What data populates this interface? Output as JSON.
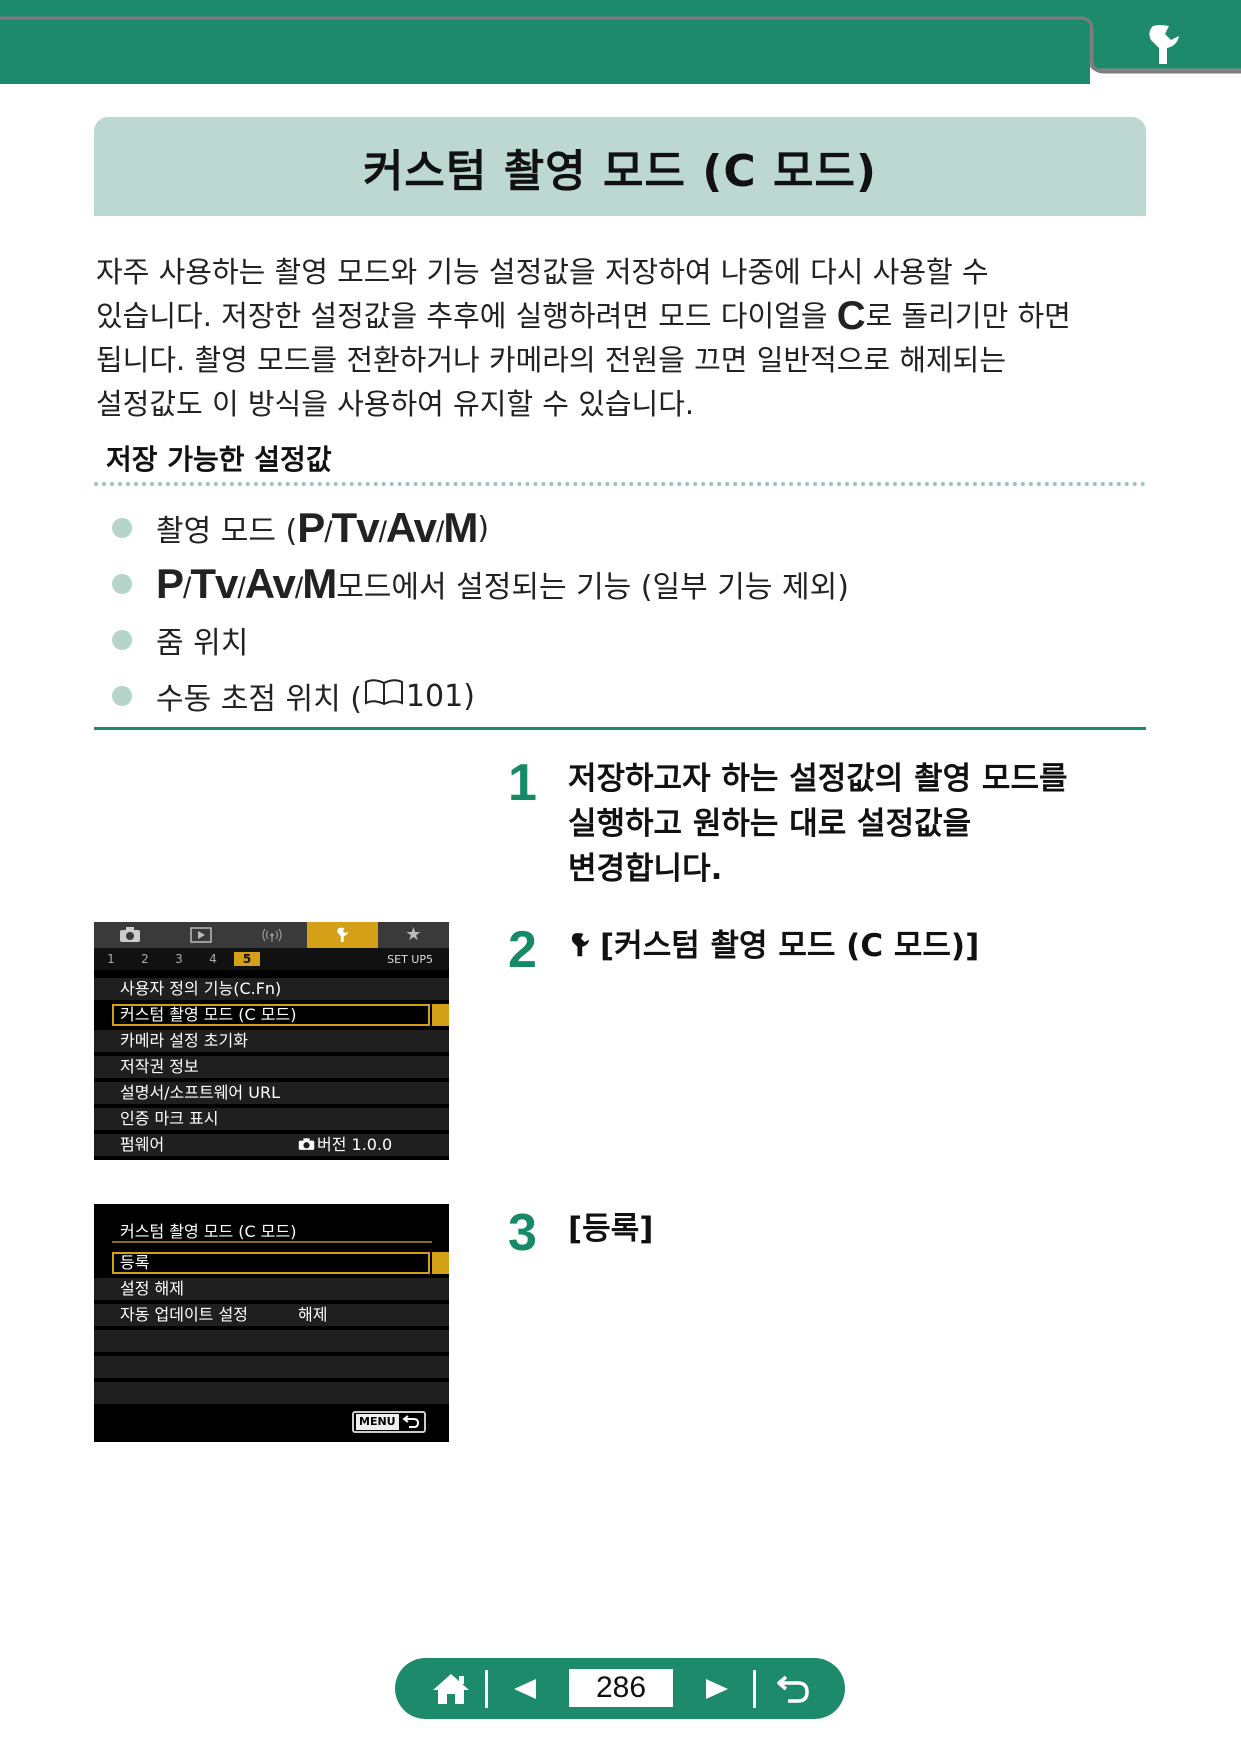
{
  "header": {
    "tab_icon": "wrench-icon",
    "band_color": "#1d8a6b"
  },
  "title": "커스텀 촬영 모드 (C 모드)",
  "intro": {
    "line1": "자주 사용하는 촬영 모드와 기능 설정값을 저장하여 나중에 다시 사용할 수",
    "line2_before": "있습니다. 저장한 설정값을 추후에 실행하려면 모드 다이얼을 ",
    "line2_mode": "C",
    "line2_after": "로 돌리기만 하면",
    "line3": "됩니다. 촬영 모드를 전환하거나 카메라의 전원을 끄면 일반적으로 해제되는",
    "line4": "설정값도 이 방식을 사용하여 유지할 수 있습니다."
  },
  "saveable": {
    "heading": "저장 가능한 설정값",
    "items": [
      {
        "prefix": "촬영 모드 (",
        "modes": [
          "P",
          "Tv",
          "Av",
          "M"
        ],
        "suffix": ")"
      },
      {
        "modes": [
          "P",
          "Tv",
          "Av",
          "M"
        ],
        "suffix": " 모드에서 설정되는 기능 (일부 기능 제외)"
      },
      {
        "text": "줌 위치"
      },
      {
        "text_before": "수동 초점 위치 (",
        "page_ref": "101",
        "text_after": ")"
      }
    ]
  },
  "steps": [
    {
      "number": "1",
      "line1": "저장하고자 하는 설정값의 촬영 모드를",
      "line2": "실행하고 원하는 대로 설정값을",
      "line3": "변경합니다."
    },
    {
      "number": "2",
      "icon": "wrench-icon",
      "text": "[커스텀 촬영 모드 (C 모드)]"
    },
    {
      "number": "3",
      "text": "[등록]"
    }
  ],
  "camera_screen_1": {
    "tabs": [
      "camera-icon",
      "playback-icon",
      "wireless-icon",
      "wrench-icon",
      "star-icon"
    ],
    "active_tab": "wrench-icon",
    "subtabs": [
      "1",
      "2",
      "3",
      "4",
      "5"
    ],
    "active_subtab": "5",
    "set_name": "SET UP5",
    "rows": [
      {
        "label": "사용자 정의 기능(C.Fn)"
      },
      {
        "label": "커스텀 촬영 모드 (C 모드)",
        "selected": true
      },
      {
        "label": "카메라 설정 초기화"
      },
      {
        "label": "저작권 정보"
      },
      {
        "label": "설명서/소프트웨어 URL"
      },
      {
        "label": "인증 마크 표시"
      },
      {
        "label": "펌웨어",
        "value": "버전 1.0.0"
      }
    ]
  },
  "camera_screen_2": {
    "title": "커스텀 촬영 모드 (C 모드)",
    "rows": [
      {
        "label": "등록",
        "selected": true
      },
      {
        "label": "설정 해제"
      },
      {
        "label": "자동 업데이트 설정",
        "value": "해제"
      }
    ],
    "menu_button": "MENU"
  },
  "nav": {
    "page": "286",
    "home_icon": "home-icon",
    "prev_icon": "prev-arrow-icon",
    "next_icon": "next-arrow-icon",
    "back_icon": "return-icon"
  }
}
